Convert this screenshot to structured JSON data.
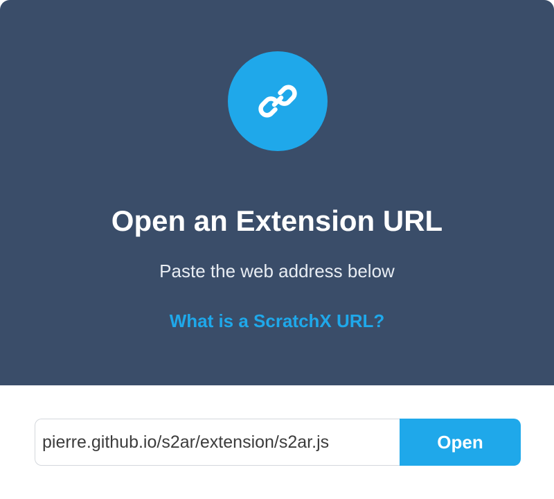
{
  "dialog": {
    "icon": "link-icon",
    "title": "Open an Extension URL",
    "subtitle": "Paste the web address below",
    "help_link": "What is a ScratchX URL?"
  },
  "url_form": {
    "input_value": "pierre.github.io/s2ar/extension/s2ar.js",
    "open_label": "Open"
  },
  "colors": {
    "header_bg": "#3a4d69",
    "accent": "#1fa8ea",
    "body_bg": "#ffffff"
  }
}
